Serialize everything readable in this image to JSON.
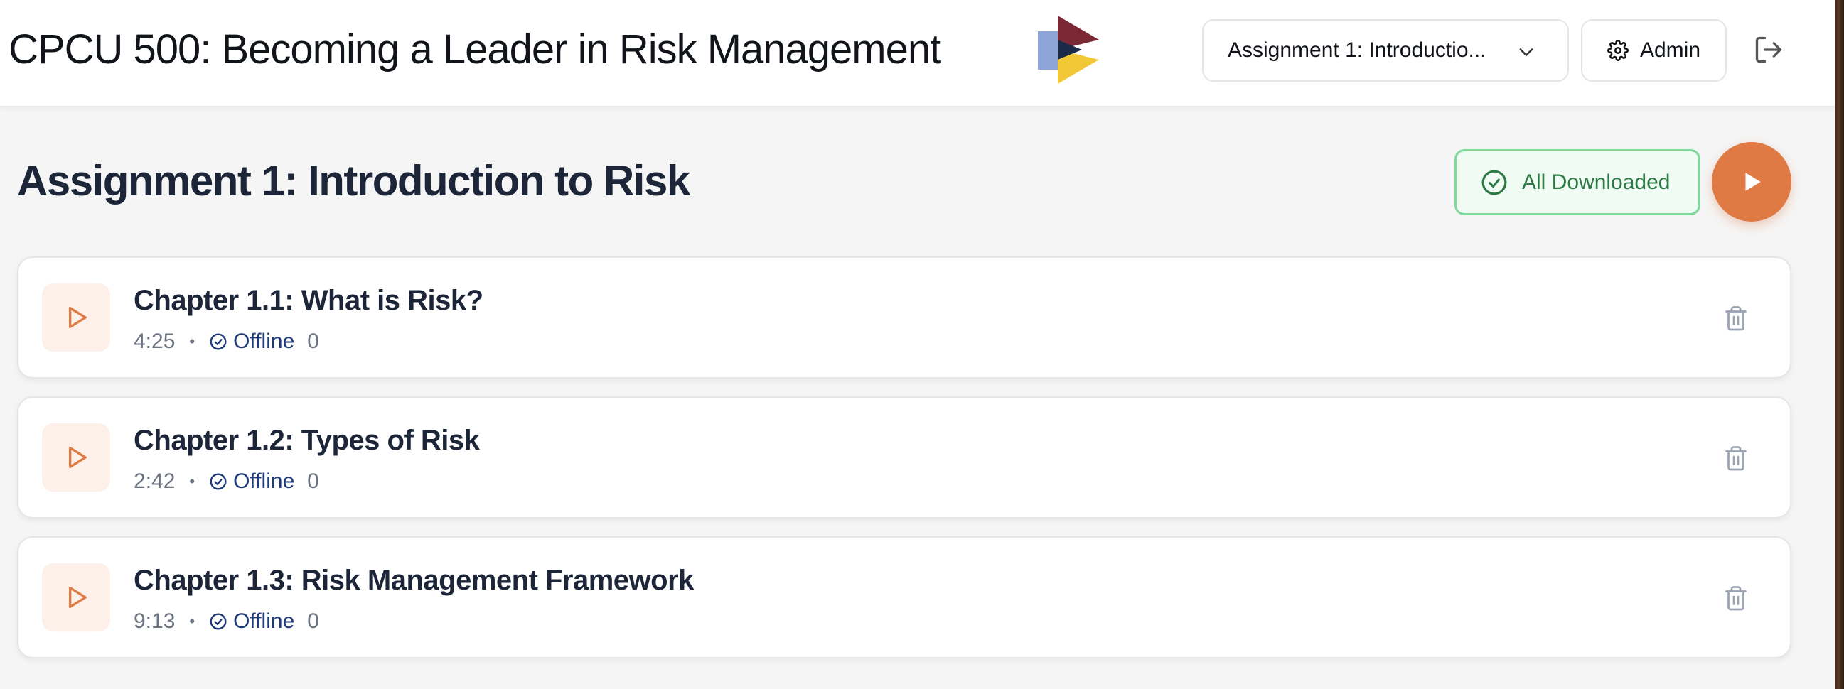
{
  "header": {
    "app_title": "CPCU 500: Becoming a Leader in Risk Management",
    "assignment_select": "Assignment 1: Introductio...",
    "admin_label": "Admin"
  },
  "main": {
    "page_title": "Assignment 1: Introduction to Risk",
    "download_status": "All Downloaded"
  },
  "chapters": [
    {
      "title": "Chapter 1.1: What is Risk?",
      "duration": "4:25",
      "status": "Offline",
      "count": "0"
    },
    {
      "title": "Chapter 1.2: Types of Risk",
      "duration": "2:42",
      "status": "Offline",
      "count": "0"
    },
    {
      "title": "Chapter 1.3: Risk Management Framework",
      "duration": "9:13",
      "status": "Offline",
      "count": "0"
    }
  ],
  "icons": {
    "logo": "play-logo-icon",
    "select_chevron": "chevron-down-icon",
    "admin": "gear-icon",
    "logout": "logout-icon",
    "downloaded": "check-circle-icon",
    "play_all": "play-icon",
    "chapter_play": "play-outline-icon",
    "offline": "check-circle-small-icon",
    "delete": "trash-icon"
  },
  "colors": {
    "accent": "#e07a45",
    "success_border": "#7ed99a",
    "success_text": "#2c7a45",
    "offline_text": "#1d3a7a",
    "logo_red": "#7b2a35",
    "logo_blue": "#8ea5d9",
    "logo_yellow": "#f2c838",
    "logo_navy": "#1c2a4a"
  }
}
